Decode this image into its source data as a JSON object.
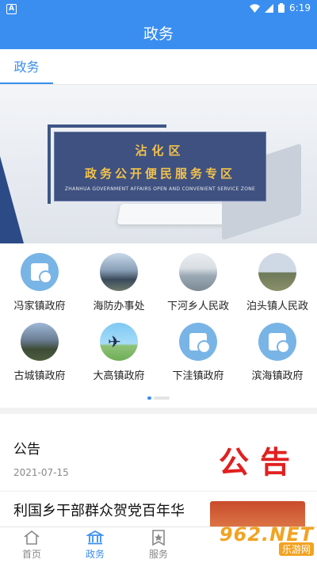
{
  "status_bar": {
    "left_badge": "A",
    "time": "6:19"
  },
  "header": {
    "title": "政务"
  },
  "tabs": [
    {
      "label": "政务"
    }
  ],
  "banner": {
    "line1": "沾化区",
    "line2": "政务公开便民服务专区",
    "line3": "ZHANHUA GOVERNMENT AFFAIRS OPEN AND CONVENIENT SERVICE ZONE"
  },
  "grid": [
    {
      "label": "冯家镇政府",
      "icon": "gov-building-icon"
    },
    {
      "label": "海防办事处",
      "icon": "photo-icon"
    },
    {
      "label": "下河乡人民政",
      "icon": "photo-icon"
    },
    {
      "label": "泊头镇人民政",
      "icon": "photo-icon"
    },
    {
      "label": "古城镇政府",
      "icon": "photo-icon"
    },
    {
      "label": "大高镇政府",
      "icon": "photo-icon"
    },
    {
      "label": "下洼镇政府",
      "icon": "gov-building-icon"
    },
    {
      "label": "滨海镇政府",
      "icon": "gov-building-icon"
    }
  ],
  "notice": {
    "title": "公告",
    "date": "2021-07-15",
    "image_text": "公告"
  },
  "news": {
    "headline": "利国乡干部群众贺党百年华"
  },
  "bottom_nav": [
    {
      "label": "首页",
      "icon": "home-icon"
    },
    {
      "label": "政务",
      "icon": "bank-icon"
    },
    {
      "label": "服务",
      "icon": "star-badge-icon"
    }
  ],
  "watermark": {
    "brand": "962.NET",
    "sub": "乐游网"
  },
  "colors": {
    "primary": "#3a8ef0",
    "notice_red": "#e12020"
  }
}
